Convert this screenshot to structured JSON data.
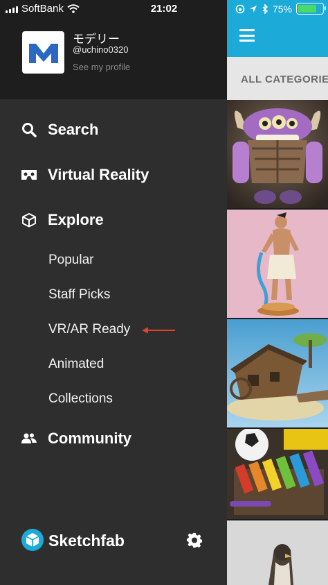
{
  "status_bar": {
    "carrier": "SoftBank",
    "time": "21:02",
    "battery": "75%",
    "battery_level": 0.75
  },
  "profile": {
    "name": "モデリー",
    "handle": "@uchino0320",
    "link": "See my profile"
  },
  "menu": {
    "search": "Search",
    "vr": "Virtual Reality",
    "explore": "Explore",
    "sub": [
      "Popular",
      "Staff Picks",
      "VR/AR Ready",
      "Animated",
      "Collections"
    ],
    "community": "Community"
  },
  "footer": {
    "brand": "Sketchfab"
  },
  "app": {
    "category_tab": "ALL CATEGORIES"
  },
  "colors": {
    "accent": "#1caad9",
    "annotation_arrow": "#e0432a",
    "drawer_bg": "#2e2e2e"
  }
}
